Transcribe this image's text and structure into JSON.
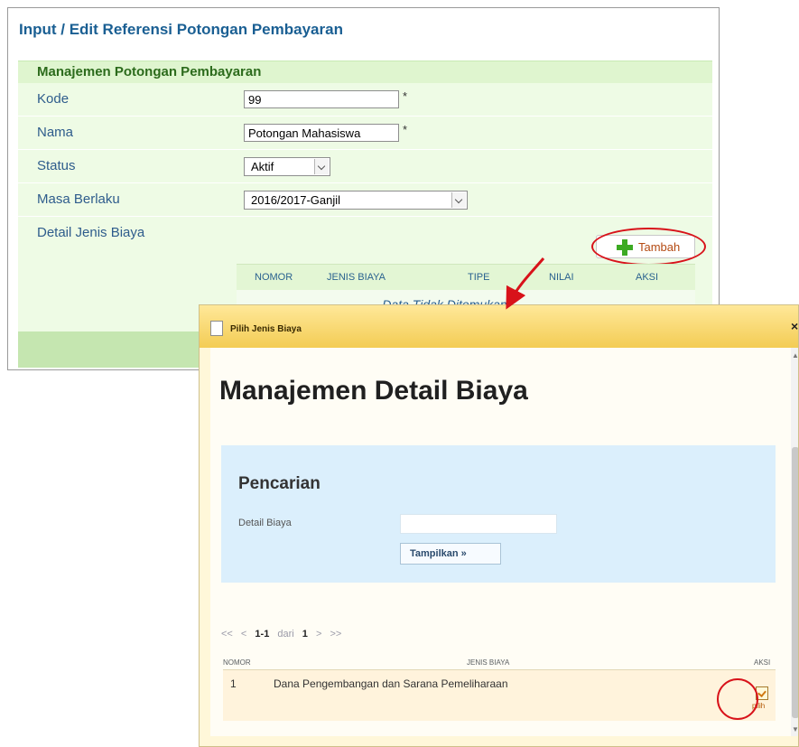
{
  "form": {
    "page_title": "Input / Edit Referensi Potongan Pembayaran",
    "section_title": "Manajemen Potongan Pembayaran",
    "fields": {
      "kode": {
        "label": "Kode",
        "value": "99",
        "required": "*"
      },
      "nama": {
        "label": "Nama",
        "value": "Potongan Mahasiswa",
        "required": "*"
      },
      "status": {
        "label": "Status",
        "selected": "Aktif"
      },
      "masa_berlaku": {
        "label": "Masa Berlaku",
        "selected": "2016/2017-Ganjil"
      },
      "detail_jenis_biaya": {
        "label": "Detail Jenis Biaya"
      }
    },
    "tambah_label": "Tambah",
    "detail_table": {
      "columns": [
        "NOMOR",
        "JENIS BIAYA",
        "TIPE",
        "NILAI",
        "AKSI"
      ],
      "empty_message": "--Data Tidak Ditemukan--"
    }
  },
  "dialog": {
    "title": "Pilih Jenis Biaya",
    "close": "×",
    "heading": "Manajemen Detail Biaya",
    "search": {
      "title": "Pencarian",
      "field_label": "Detail Biaya",
      "field_value": "",
      "button_label": "Tampilkan »"
    },
    "pager": {
      "first": "<<",
      "prev": "<",
      "range": "1-1",
      "dari": "dari",
      "total": "1",
      "next": ">",
      "last": ">>"
    },
    "results": {
      "columns": [
        "NOMOR",
        "JENIS BIAYA",
        "AKSI"
      ],
      "rows": [
        {
          "nomor": "1",
          "jenis_biaya": "Dana Pengembangan dan Sarana Pemeliharaan",
          "aksi": "pilih"
        }
      ]
    }
  },
  "colors": {
    "title_blue": "#1a5f93",
    "header_green": "#dff5cf",
    "dialog_gold": "#f3cc54",
    "annotation_red": "#d8121a"
  }
}
